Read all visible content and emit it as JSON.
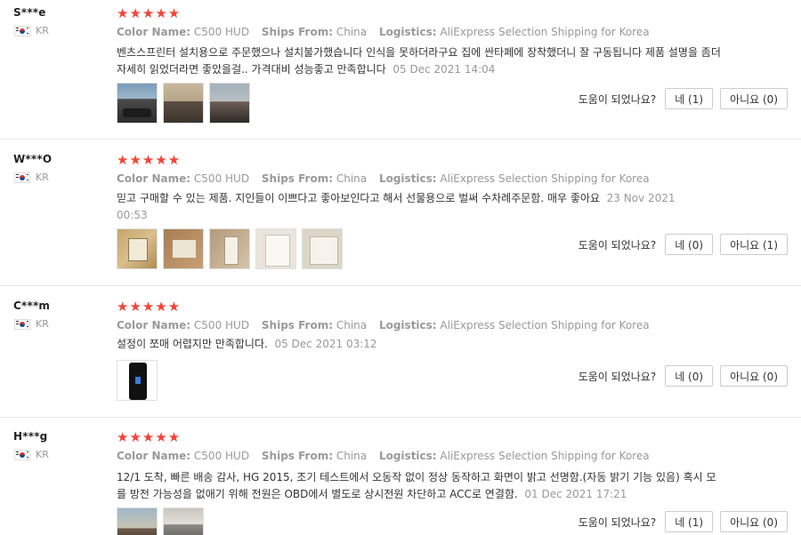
{
  "labels": {
    "color_name": "Color Name:",
    "ships_from": "Ships From:",
    "logistics": "Logistics:",
    "helpful": "도움이 되었나요?"
  },
  "stars": "★★★★★",
  "reviews": [
    {
      "user": "S***e",
      "country": "KR",
      "color_name": "C500 HUD",
      "ships_from": "China",
      "logistics": "AliExpress Selection Shipping for Korea",
      "text": "벤츠스프린터 설치용으로 주문했으나 설치불가했습니다 인식을 못하더라구요 집에 싼타페에 장착했더니 잘 구동됩니다 제품 설명을 좀더 자세히 읽었더라면 좋았을걸.. 가격대비 성능좋고 만족합니다",
      "date": "05 Dec 2021 14:04",
      "yes": "네 (1)",
      "no": "아니요 (0)"
    },
    {
      "user": "W***O",
      "country": "KR",
      "color_name": "C500 HUD",
      "ships_from": "China",
      "logistics": "AliExpress Selection Shipping for Korea",
      "text": "믿고 구매할 수 있는 제품. 지인들이 이쁘다고 좋아보인다고 해서 선물용으로 벌써 수차례주문함. 매우 좋아요",
      "date": "23 Nov 2021 00:53",
      "yes": "네 (0)",
      "no": "아니요 (1)"
    },
    {
      "user": "C***m",
      "country": "KR",
      "color_name": "C500 HUD",
      "ships_from": "China",
      "logistics": "AliExpress Selection Shipping for Korea",
      "text": "설정이 쪼매 어렵지만 만족합니다.",
      "date": "05 Dec 2021 03:12",
      "yes": "네 (0)",
      "no": "아니요 (0)"
    },
    {
      "user": "H***g",
      "country": "KR",
      "color_name": "C500 HUD",
      "ships_from": "China",
      "logistics": "AliExpress Selection Shipping for Korea",
      "text": "12/1 도착, 빠른 배송 감사, HG 2015, 조기 테스트에서 오동작 없이 정상 동작하고 화면이 밝고 선명함.(자동 밝기 기능 있음) 혹시 모를 방전 가능성을 없애기 위해 전원은 OBD에서 별도로 상시전원 차단하고 ACC로 연결함.",
      "date": "01 Dec 2021 17:21",
      "yes": "네 (1)",
      "no": "아니요 (0)"
    }
  ]
}
